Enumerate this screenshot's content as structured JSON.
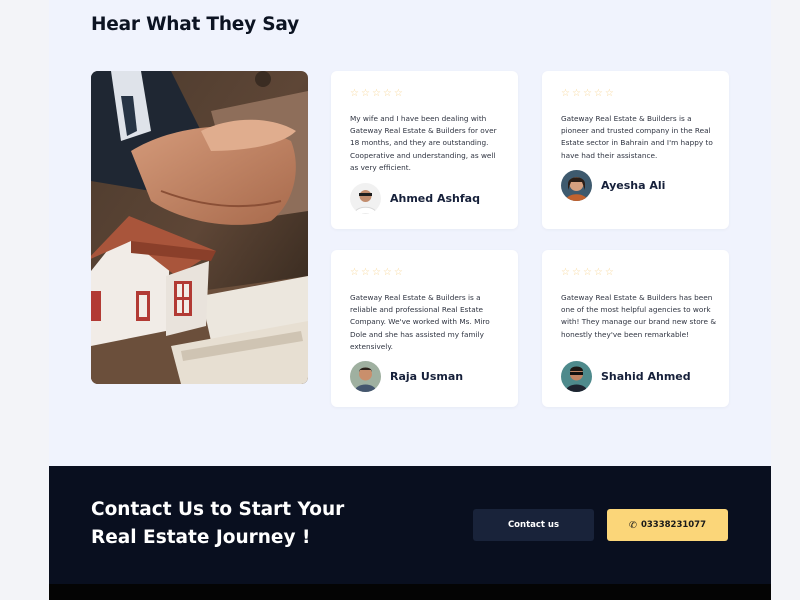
{
  "testimonials_section": {
    "title": "Hear What They Say",
    "star_glyph": "☆",
    "star_color": "#f7d79a",
    "items": [
      {
        "quote": "My wife and I have been dealing with Gateway Real Estate & Builders for over 18 months, and they are outstanding. Cooperative and understanding, as well as very efficient.",
        "author": "Ahmed Ashfaq"
      },
      {
        "quote": "Gateway Real Estate & Builders is a pioneer and trusted company in the Real Estate sector in Bahrain and I'm happy to have had their assistance.",
        "author": "Ayesha Ali"
      },
      {
        "quote": "Gateway Real Estate & Builders is a reliable and professional Real Estate Company. We've worked with Ms. Miro Dole and she has assisted my family extensively.",
        "author": "Raja Usman"
      },
      {
        "quote": "Gateway Real Estate & Builders has been one of the most helpful agencies to work with! They manage our brand new store & honestly they've been remarkable!",
        "author": "Shahid Ahmed"
      }
    ]
  },
  "cta": {
    "title": "Contact Us to Start Your Real Estate Journey !",
    "contact_button": "Contact us",
    "phone_button": "03338231077",
    "phone_icon": "phone-icon"
  },
  "colors": {
    "dark_bg": "#090f1f",
    "accent": "#fbd679",
    "page_bg": "#f0f3fd"
  }
}
